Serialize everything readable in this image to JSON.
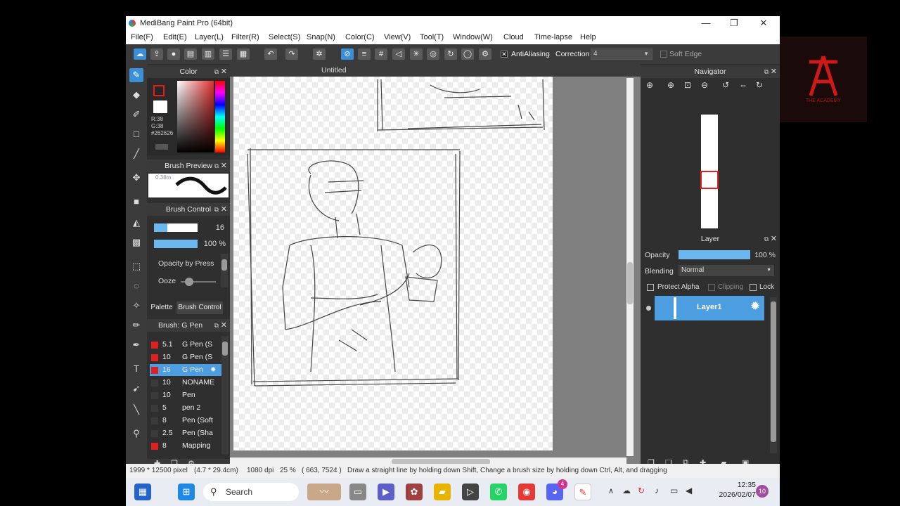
{
  "window": {
    "title": "MediBang Paint Pro (64bit)"
  },
  "menu": [
    "File(F)",
    "Edit(E)",
    "Layer(L)",
    "Filter(R)",
    "Select(S)",
    "Snap(N)",
    "Color(C)",
    "View(V)",
    "Tool(T)",
    "Window(W)",
    "Cloud",
    "Time-lapse",
    "Help"
  ],
  "toolbar": {
    "antialiasing_label": "AntiAliasing",
    "correction_label": "Correction",
    "correction_value": "4",
    "soft_edge_label": "Soft Edge"
  },
  "color_panel": {
    "title": "Color",
    "r": "R:38",
    "g": "G:38",
    "hex": "#262626",
    "fg_color": "#262626",
    "accent": "#e02020"
  },
  "brush_preview": {
    "title": "Brush Preview",
    "size_text": "0.38m"
  },
  "brush_control": {
    "title": "Brush Control",
    "size_value": "16",
    "opacity_value": "100 %",
    "opacity_by_pressure": "Opacity by Press",
    "ooze_label": "Ooze"
  },
  "tabs": {
    "palette": "Palette",
    "brush_control": "Brush Control"
  },
  "brush_list": {
    "title": "Brush: G Pen",
    "items": [
      {
        "size": "5.1",
        "name": "G Pen (S",
        "color": "#e02020"
      },
      {
        "size": "10",
        "name": "G Pen (S",
        "color": "#e02020"
      },
      {
        "size": "16",
        "name": "G Pen",
        "color": "#e02020"
      },
      {
        "size": "10",
        "name": "NONAME",
        "color": "#3a3a3a"
      },
      {
        "size": "10",
        "name": "Pen",
        "color": "#3a3a3a"
      },
      {
        "size": "5",
        "name": "pen 2",
        "color": "#3a3a3a"
      },
      {
        "size": "8",
        "name": "Pen (Soft",
        "color": "#3a3a3a"
      },
      {
        "size": "2.5",
        "name": "Pen (Sha",
        "color": "#3a3a3a"
      },
      {
        "size": "8",
        "name": "Mapping",
        "color": "#e02020"
      }
    ]
  },
  "canvas": {
    "tab_title": "Untitled"
  },
  "navigator": {
    "title": "Navigator"
  },
  "layer_panel": {
    "title": "Layer",
    "opacity_label": "Opacity",
    "opacity_value": "100 %",
    "blending_label": "Blending",
    "blending_value": "Normal",
    "protect_alpha": "Protect Alpha",
    "clipping": "Clipping",
    "lock": "Lock",
    "layer_name": "Layer1"
  },
  "status": {
    "size": "1999 * 12500 pixel",
    "cm": "(4.7 * 29.4cm)",
    "dpi": "1080 dpi",
    "zoom": "25 %",
    "coords": "( 663, 7524 )",
    "hint": "Draw a straight line by holding down Shift, Change a brush size by holding down Ctrl, Alt, and dragging"
  },
  "taskbar": {
    "search": "Search",
    "time": "12:35",
    "date": "2026/02/07",
    "notification_count": "10",
    "app_badge": "4"
  },
  "watermark": {
    "text": "THE ACADEMY"
  }
}
